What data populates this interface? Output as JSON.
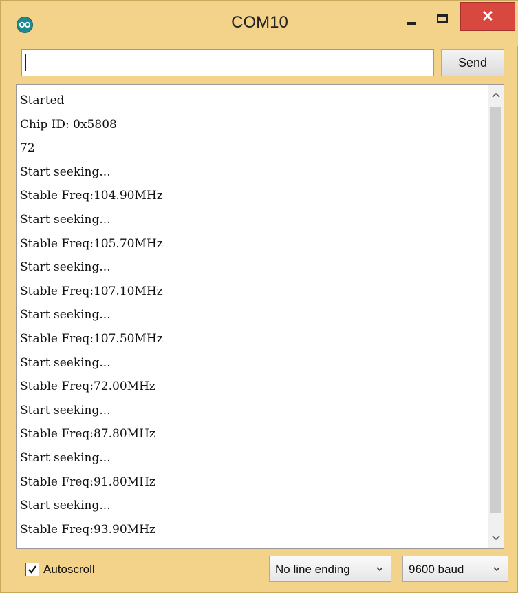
{
  "window": {
    "title": "COM10",
    "minimize_icon": "minimize-icon",
    "maximize_icon": "maximize-icon",
    "close_icon": "close-icon",
    "close_glyph": "✕",
    "app_icon": "arduino-icon"
  },
  "input": {
    "value": "",
    "send_label": "Send"
  },
  "output": {
    "lines": [
      "Started",
      "Chip ID: 0x5808",
      "72",
      "Start seeking...",
      "Stable Freq:104.90MHz",
      "Start seeking...",
      "Stable Freq:105.70MHz",
      "Start seeking...",
      "Stable Freq:107.10MHz",
      "Start seeking...",
      "Stable Freq:107.50MHz",
      "Start seeking...",
      "Stable Freq:72.00MHz",
      "Start seeking...",
      "Stable Freq:87.80MHz",
      "Start seeking...",
      "Stable Freq:91.80MHz",
      "Start seeking...",
      "Stable Freq:93.90MHz"
    ]
  },
  "footer": {
    "autoscroll_label": "Autoscroll",
    "autoscroll_checked": true,
    "line_ending": "No line ending",
    "baud_rate": "9600 baud"
  },
  "colors": {
    "frame": "#f3d38a",
    "close": "#d9483f",
    "app_icon": "#1c8a8f"
  }
}
